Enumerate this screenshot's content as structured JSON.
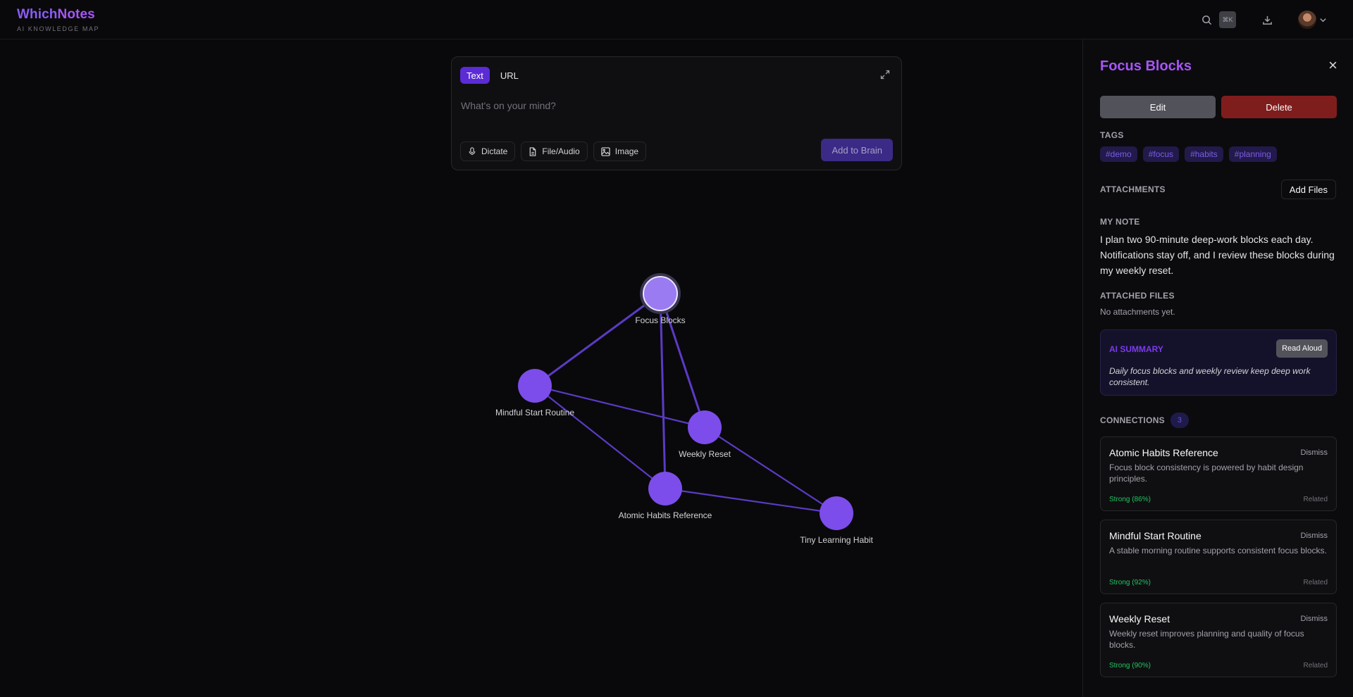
{
  "app": {
    "brand_part1": "Which",
    "brand_part2": "Notes",
    "subtitle": "AI KNOWLEDGE MAP",
    "shortcut": "⌘K"
  },
  "composer": {
    "tabs": [
      "Text",
      "URL"
    ],
    "active_tab": "Text",
    "placeholder": "What's on your mind?",
    "value": "",
    "actions": [
      "Dictate",
      "File/Audio",
      "Image"
    ],
    "submit_label": "Add to Brain"
  },
  "graph": {
    "nodes": [
      {
        "id": "focus",
        "label": "Focus Blocks",
        "selected": true
      },
      {
        "id": "mindful",
        "label": "Mindful Start Routine"
      },
      {
        "id": "weekly",
        "label": "Weekly Reset"
      },
      {
        "id": "atomic",
        "label": "Atomic Habits Reference"
      },
      {
        "id": "tiny",
        "label": "Tiny Learning Habit"
      }
    ],
    "edges": [
      [
        "focus",
        "mindful"
      ],
      [
        "focus",
        "weekly"
      ],
      [
        "focus",
        "atomic"
      ],
      [
        "mindful",
        "weekly"
      ],
      [
        "mindful",
        "atomic"
      ],
      [
        "weekly",
        "tiny"
      ],
      [
        "atomic",
        "tiny"
      ]
    ],
    "colors": {
      "node": "#7c4dea",
      "node_selected": "#9b7bf2",
      "edge": "#5b3bc4"
    }
  },
  "panel": {
    "title": "Focus Blocks",
    "edit_label": "Edit",
    "delete_label": "Delete",
    "tags_label": "TAGS",
    "tags": [
      "#demo",
      "#focus",
      "#habits",
      "#planning"
    ],
    "attachments_label": "ATTACHMENTS",
    "add_files_label": "Add Files",
    "my_note_label": "MY NOTE",
    "note": "I plan two 90-minute deep-work blocks each day. Notifications stay off, and I review these blocks during my weekly reset.",
    "attached_files_label": "ATTACHED FILES",
    "no_attachments": "No attachments yet.",
    "ai_summary_label": "AI SUMMARY",
    "read_aloud_label": "Read Aloud",
    "ai_summary": "Daily focus blocks and weekly review keep deep work consistent.",
    "connections_label": "CONNECTIONS",
    "connections_count": "3",
    "connections": [
      {
        "title": "Atomic Habits Reference",
        "dismiss": "Dismiss",
        "desc": "Focus block consistency is powered by habit design principles.",
        "strength": "Strong (86%)",
        "type": "Related"
      },
      {
        "title": "Mindful Start Routine",
        "dismiss": "Dismiss",
        "desc": "A stable morning routine supports consistent focus blocks.",
        "strength": "Strong (92%)",
        "type": "Related"
      },
      {
        "title": "Weekly Reset",
        "dismiss": "Dismiss",
        "desc": "Weekly reset improves planning and quality of focus blocks.",
        "strength": "Strong (90%)",
        "type": "Related"
      }
    ]
  }
}
